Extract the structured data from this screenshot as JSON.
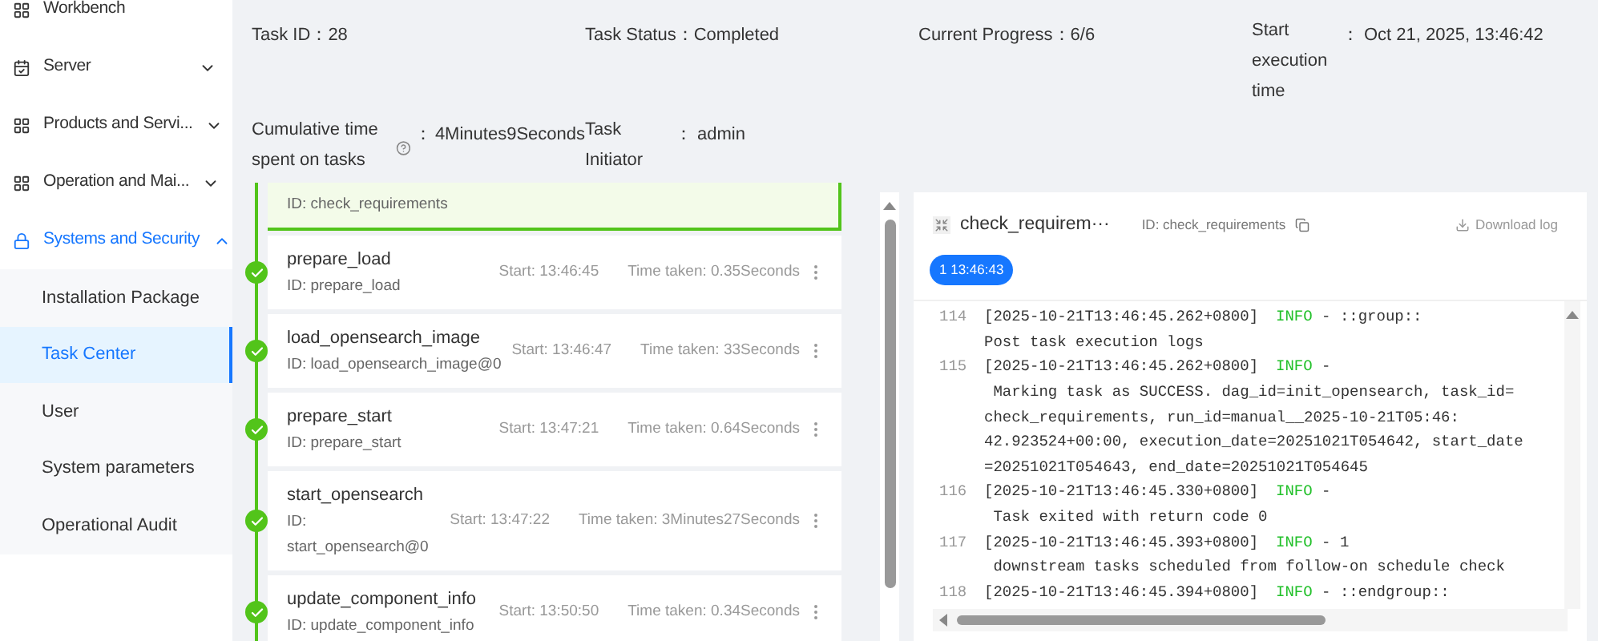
{
  "sidebar": {
    "items": [
      {
        "label": "Workbench",
        "selected": false
      },
      {
        "label": "Server",
        "selected": false,
        "expanded": false
      },
      {
        "label": "Products and Servi...",
        "selected": false,
        "expanded": false
      },
      {
        "label": "Operation and Mai...",
        "selected": false,
        "expanded": false
      },
      {
        "label": "Systems and Security",
        "selected": true,
        "expanded": true,
        "children": [
          {
            "label": "Installation Package",
            "selected": false
          },
          {
            "label": "Task Center",
            "selected": true
          },
          {
            "label": "User",
            "selected": false
          },
          {
            "label": "System parameters",
            "selected": false
          },
          {
            "label": "Operational Audit",
            "selected": false
          }
        ]
      }
    ]
  },
  "task_info": {
    "fields": [
      {
        "kind": "inline",
        "label": "Task ID：",
        "value": "28"
      },
      {
        "kind": "inline",
        "label": "Task Status：",
        "value": "Completed"
      },
      {
        "kind": "inline",
        "label": "Current Progress：",
        "value": "6/6"
      },
      {
        "kind": "aligned",
        "label": "Start execution time",
        "separator": "：",
        "value": "Oct 21, 2025, 13:46:42"
      },
      {
        "kind": "aligned",
        "label": "Cumulative time spent on tasks",
        "help": true,
        "separator": "：",
        "value": "4Minutes9Seconds"
      },
      {
        "kind": "aligned",
        "label": "Task Initiator",
        "separator": "：",
        "value": "admin"
      }
    ]
  },
  "steps": [
    {
      "id": "ID: check_requirements",
      "selected": true
    },
    {
      "name": "prepare_load",
      "id": "ID: prepare_load",
      "start": "Start: 13:46:45",
      "time_taken": "Time taken: 0.35Seconds",
      "selected": false,
      "done": true
    },
    {
      "name": "load_opensearch_image",
      "id": "ID: load_opensearch_image@0",
      "start": "Start: 13:46:47",
      "time_taken": "Time taken: 33Seconds",
      "selected": false,
      "done": true
    },
    {
      "name": "prepare_start",
      "id": "ID: prepare_start",
      "start": "Start: 13:47:21",
      "time_taken": "Time taken: 0.64Seconds",
      "selected": false,
      "done": true
    },
    {
      "name": "start_opensearch",
      "id": "ID: start_opensearch@0",
      "start": "Start: 13:47:22",
      "time_taken": "Time taken: 3Minutes27Seconds",
      "selected": false,
      "done": true
    },
    {
      "name": "update_component_info",
      "id": "ID: update_component_info",
      "start": "Start: 13:50:50",
      "time_taken": "Time taken: 0.34Seconds",
      "selected": false,
      "done": true
    }
  ],
  "log_panel": {
    "title": "check_requirem···",
    "id": "ID: check_requirements",
    "download": "Download log",
    "attempt": "1 13:46:43",
    "lines": [
      {
        "number": "114",
        "timestamp": "[2025-10-21T13:46:45.262+0800]",
        "level": "INFO",
        "head": " - ::group::",
        "body": [
          "Post task execution logs"
        ]
      },
      {
        "number": "115",
        "timestamp": "[2025-10-21T13:46:45.262+0800]",
        "level": "INFO",
        "head": " -",
        "body": [
          " Marking task as SUCCESS. dag_id=init_opensearch, task_id=",
          "check_requirements, run_id=manual__2025-10-21T05:46:",
          "42.923524+00:00, execution_date=20251021T054642, start_date",
          "=20251021T054643, end_date=20251021T054645"
        ]
      },
      {
        "number": "116",
        "timestamp": "[2025-10-21T13:46:45.330+0800]",
        "level": "INFO",
        "head": " -",
        "body": [
          " Task exited with return code 0"
        ]
      },
      {
        "number": "117",
        "timestamp": "[2025-10-21T13:46:45.393+0800]",
        "level": "INFO",
        "head": " - 1",
        "body": [
          " downstream tasks scheduled from follow-on schedule check"
        ]
      },
      {
        "number": "118",
        "timestamp": "[2025-10-21T13:46:45.394+0800]",
        "level": "INFO",
        "head": " - ::endgroup::"
      }
    ]
  }
}
